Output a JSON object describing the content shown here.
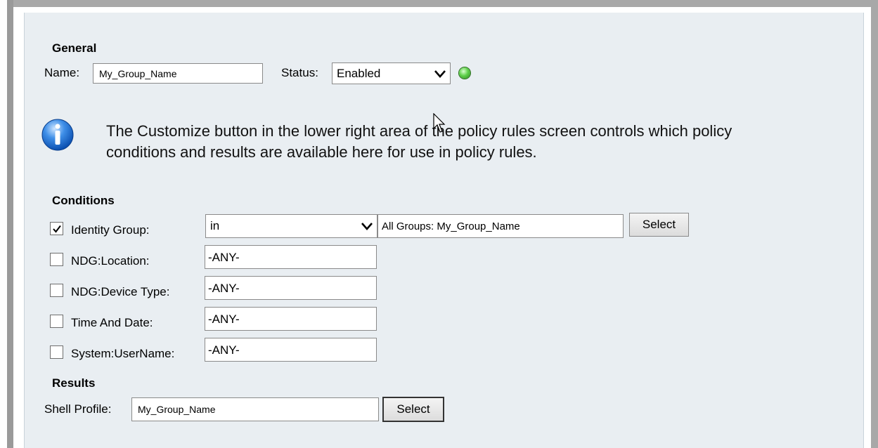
{
  "general": {
    "title": "General",
    "name_label": "Name:",
    "name_value": "My_Group_Name",
    "status_label": "Status:",
    "status_value": "Enabled",
    "status_color": "#4cc23a"
  },
  "info": {
    "icon": "info-icon",
    "line1": "The Customize button in the lower right area of the policy rules screen controls which policy",
    "line2": "conditions and results are available here for use in policy rules."
  },
  "conditions": {
    "title": "Conditions",
    "identity_group": {
      "checked": true,
      "label": "Identity Group:",
      "operator": "in",
      "value": "All Groups: My_Group_Name",
      "button": "Select"
    },
    "ndg_location": {
      "checked": false,
      "label": "NDG:Location:",
      "value": "-ANY-"
    },
    "ndg_device_type": {
      "checked": false,
      "label": "NDG:Device Type:",
      "value": "-ANY-"
    },
    "time_and_date": {
      "checked": false,
      "label": "Time And Date:",
      "value": "-ANY-"
    },
    "system_username": {
      "checked": false,
      "label": "System:UserName:",
      "value": "-ANY-"
    }
  },
  "results": {
    "title": "Results",
    "shell_profile_label": "Shell Profile:",
    "shell_profile_value": "My_Group_Name",
    "button": "Select"
  }
}
